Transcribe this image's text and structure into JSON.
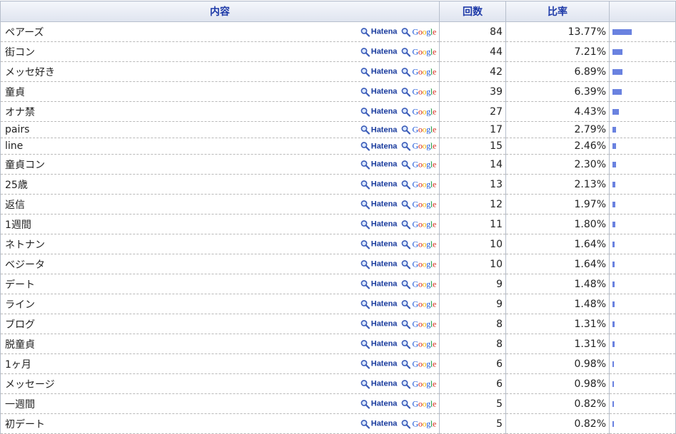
{
  "headers": {
    "content": "内容",
    "count": "回数",
    "ratio": "比率",
    "bar": ""
  },
  "links": {
    "hatena": "Hatena",
    "google": "Google"
  },
  "colors": {
    "bar": "#6a82e0",
    "header_text": "#1e3aa8"
  },
  "rows": [
    {
      "content": "ペアーズ",
      "count": "84",
      "ratio": "13.77%",
      "bar_percent": 13.77
    },
    {
      "content": "街コン",
      "count": "44",
      "ratio": "7.21%",
      "bar_percent": 7.21
    },
    {
      "content": "メッセ好き",
      "count": "42",
      "ratio": "6.89%",
      "bar_percent": 6.89
    },
    {
      "content": "童貞",
      "count": "39",
      "ratio": "6.39%",
      "bar_percent": 6.39
    },
    {
      "content": "オナ禁",
      "count": "27",
      "ratio": "4.43%",
      "bar_percent": 4.43
    },
    {
      "content": "pairs",
      "count": "17",
      "ratio": "2.79%",
      "bar_percent": 2.79
    },
    {
      "content": "line",
      "count": "15",
      "ratio": "2.46%",
      "bar_percent": 2.46
    },
    {
      "content": "童貞コン",
      "count": "14",
      "ratio": "2.30%",
      "bar_percent": 2.3
    },
    {
      "content": "25歳",
      "count": "13",
      "ratio": "2.13%",
      "bar_percent": 2.13
    },
    {
      "content": "返信",
      "count": "12",
      "ratio": "1.97%",
      "bar_percent": 1.97
    },
    {
      "content": "1週間",
      "count": "11",
      "ratio": "1.80%",
      "bar_percent": 1.8
    },
    {
      "content": "ネトナン",
      "count": "10",
      "ratio": "1.64%",
      "bar_percent": 1.64
    },
    {
      "content": "ベジータ",
      "count": "10",
      "ratio": "1.64%",
      "bar_percent": 1.64
    },
    {
      "content": "デート",
      "count": "9",
      "ratio": "1.48%",
      "bar_percent": 1.48
    },
    {
      "content": "ライン",
      "count": "9",
      "ratio": "1.48%",
      "bar_percent": 1.48
    },
    {
      "content": "ブログ",
      "count": "8",
      "ratio": "1.31%",
      "bar_percent": 1.31
    },
    {
      "content": "脱童貞",
      "count": "8",
      "ratio": "1.31%",
      "bar_percent": 1.31
    },
    {
      "content": "1ヶ月",
      "count": "6",
      "ratio": "0.98%",
      "bar_percent": 0.98
    },
    {
      "content": "メッセージ",
      "count": "6",
      "ratio": "0.98%",
      "bar_percent": 0.98
    },
    {
      "content": "一週間",
      "count": "5",
      "ratio": "0.82%",
      "bar_percent": 0.82
    },
    {
      "content": "初デート",
      "count": "5",
      "ratio": "0.82%",
      "bar_percent": 0.82
    }
  ]
}
